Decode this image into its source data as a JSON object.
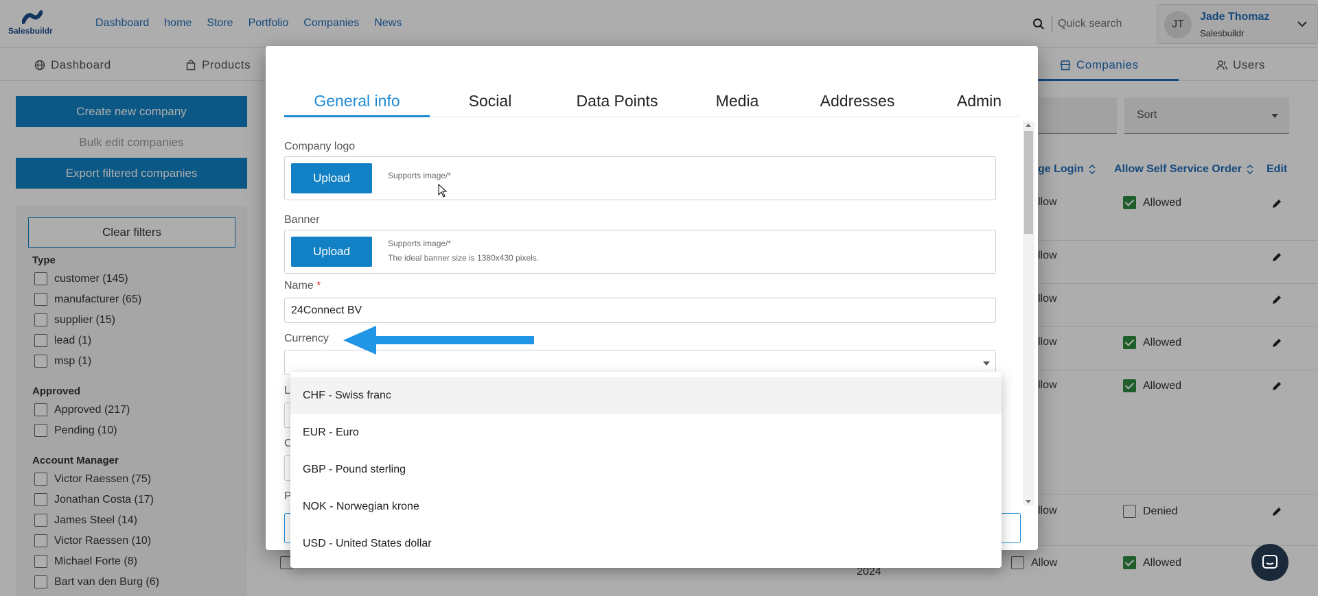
{
  "brand": {
    "name": "Salesbuildr"
  },
  "topnav": [
    "Dashboard",
    "home",
    "Store",
    "Portfolio",
    "Companies",
    "News"
  ],
  "search": {
    "placeholder": "Quick search"
  },
  "user": {
    "initials": "JT",
    "name": "Jade Thomaz",
    "company": "Salesbuildr"
  },
  "subnav": {
    "dashboard": "Dashboard",
    "products": "Products",
    "companies": "Companies",
    "users": "Users"
  },
  "sidebar": {
    "create": "Create new company",
    "bulk_edit": "Bulk edit companies",
    "export": "Export filtered companies",
    "clear": "Clear filters",
    "groups": {
      "type": {
        "title": "Type",
        "items": [
          "customer (145)",
          "manufacturer (65)",
          "supplier (15)",
          "lead (1)",
          "msp (1)"
        ]
      },
      "approved": {
        "title": "Approved",
        "items": [
          "Approved (217)",
          "Pending (10)"
        ]
      },
      "account_manager": {
        "title": "Account Manager",
        "items": [
          "Victor Raessen (75)",
          "Jonathan Costa (17)",
          "James Steel (14)",
          "Victor Raessen (10)",
          "Michael Forte (8)",
          "Bart van den Burg (6)"
        ]
      }
    }
  },
  "table": {
    "sort_label": "Sort",
    "headers": {
      "login": "ge Login",
      "self_service": "Allow Self Service Order",
      "edit": "Edit"
    },
    "rows": [
      {
        "login": "llow",
        "self": "Allowed"
      },
      {
        "login": "llow",
        "self": ""
      },
      {
        "login": "llow",
        "self": ""
      },
      {
        "login": "llow",
        "self": "Allowed"
      },
      {
        "login": "llow",
        "self": "Allowed"
      },
      {
        "login": "llow",
        "self": "Denied"
      },
      {
        "login": "Allow",
        "self": "Allowed"
      }
    ],
    "year": "2024"
  },
  "modal": {
    "tabs": [
      "General info",
      "Social",
      "Data Points",
      "Media",
      "Addresses",
      "Admin"
    ],
    "company_logo": {
      "label": "Company logo",
      "button": "Upload",
      "hint": "Supports image/*"
    },
    "banner": {
      "label": "Banner",
      "button": "Upload",
      "hint1": "Supports image/*",
      "hint2": "The ideal banner size is 1380x430 pixels."
    },
    "name": {
      "label": "Name",
      "required": "*",
      "value": "24Connect BV"
    },
    "currency": {
      "label": "Currency",
      "value": ""
    },
    "partial_labels": [
      "L",
      "C",
      "P"
    ]
  },
  "currency_options": [
    "CHF - Swiss franc",
    "EUR - Euro",
    "GBP - Pound sterling",
    "NOK - Norwegian krone",
    "USD - United States dollar"
  ],
  "colors": {
    "primary": "#1180c4",
    "link": "#1e6bb8",
    "accent_tab": "#1e8ad6",
    "arrow": "#2196e6",
    "allowed_check": "#2e8b3e"
  },
  "icons": [
    "search-icon",
    "chevron-down-icon",
    "globe-icon",
    "bag-icon",
    "store-icon",
    "users-icon",
    "sort-icon",
    "pencil-icon",
    "chat-icon"
  ]
}
